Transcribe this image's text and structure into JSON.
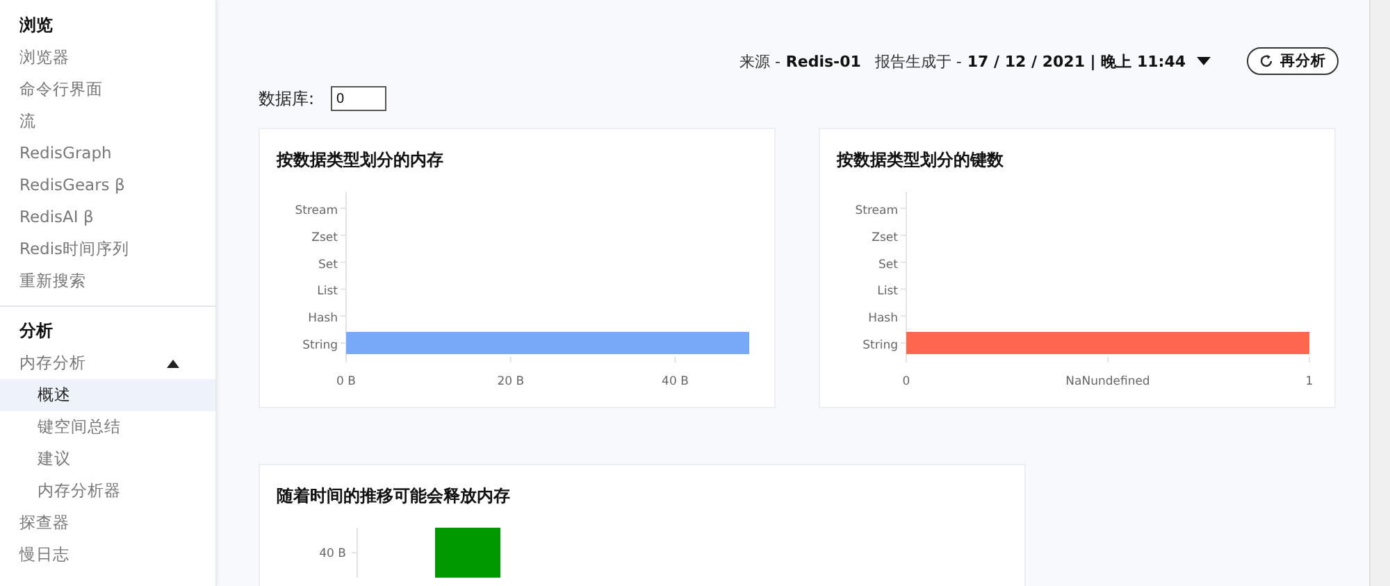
{
  "sidebar": {
    "sections": [
      {
        "title": "浏览",
        "items": [
          {
            "label": "浏览器",
            "selected": false
          },
          {
            "label": "命令行界面",
            "selected": false
          },
          {
            "label": "流",
            "selected": false
          },
          {
            "label": "RedisGraph",
            "selected": false
          },
          {
            "label": "RedisGears β",
            "selected": false
          },
          {
            "label": "RedisAI β",
            "selected": false
          },
          {
            "label": "Redis时间序列",
            "selected": false
          },
          {
            "label": "重新搜索",
            "selected": false
          }
        ]
      },
      {
        "title": "分析",
        "items": [
          {
            "label": "内存分析",
            "selected": false,
            "expanded": true,
            "children": [
              {
                "label": "概述",
                "selected": true
              },
              {
                "label": "键空间总结",
                "selected": false
              },
              {
                "label": "建议",
                "selected": false
              },
              {
                "label": "内存分析器",
                "selected": false
              }
            ]
          },
          {
            "label": "探查器",
            "selected": false
          },
          {
            "label": "慢日志",
            "selected": false
          }
        ]
      }
    ]
  },
  "report": {
    "source_label": "来源 -",
    "source": "Redis-01",
    "generated_label": "报告生成于 -",
    "generated_at": "17 / 12 / 2021 | 晚上 11:44",
    "reanalyze_button": "再分析"
  },
  "database": {
    "label": "数据库:",
    "value": "0"
  },
  "panels": [
    {
      "title": "按数据类型划分的内存",
      "chart_data": {
        "type": "bar",
        "orientation": "horizontal",
        "categories": [
          "Stream",
          "Zset",
          "Set",
          "List",
          "Hash",
          "String"
        ],
        "series": [
          {
            "color": "#78a8f8",
            "values": [
              0,
              0,
              0,
              0,
              0,
              49
            ]
          }
        ],
        "xlim": [
          0,
          49
        ],
        "xticks": [
          {
            "value": 0,
            "label": "0 B"
          },
          {
            "value": 20,
            "label": "20 B"
          },
          {
            "value": 40,
            "label": "40 B"
          }
        ]
      }
    },
    {
      "title": "按数据类型划分的键数",
      "chart_data": {
        "type": "bar",
        "orientation": "horizontal",
        "categories": [
          "Stream",
          "Zset",
          "Set",
          "List",
          "Hash",
          "String"
        ],
        "series": [
          {
            "color": "#ff6650",
            "values": [
              0,
              0,
              0,
              0,
              0,
              1
            ]
          }
        ],
        "xlim": [
          0,
          1
        ],
        "xticks": [
          {
            "value": 0,
            "label": "0"
          },
          {
            "value": 0.5,
            "label": "NaNundefined"
          },
          {
            "value": 1,
            "label": "1"
          }
        ]
      }
    }
  ],
  "freeable_panel": {
    "title": "随着时间的推移可能会释放内存",
    "tick_label": "40 B"
  }
}
